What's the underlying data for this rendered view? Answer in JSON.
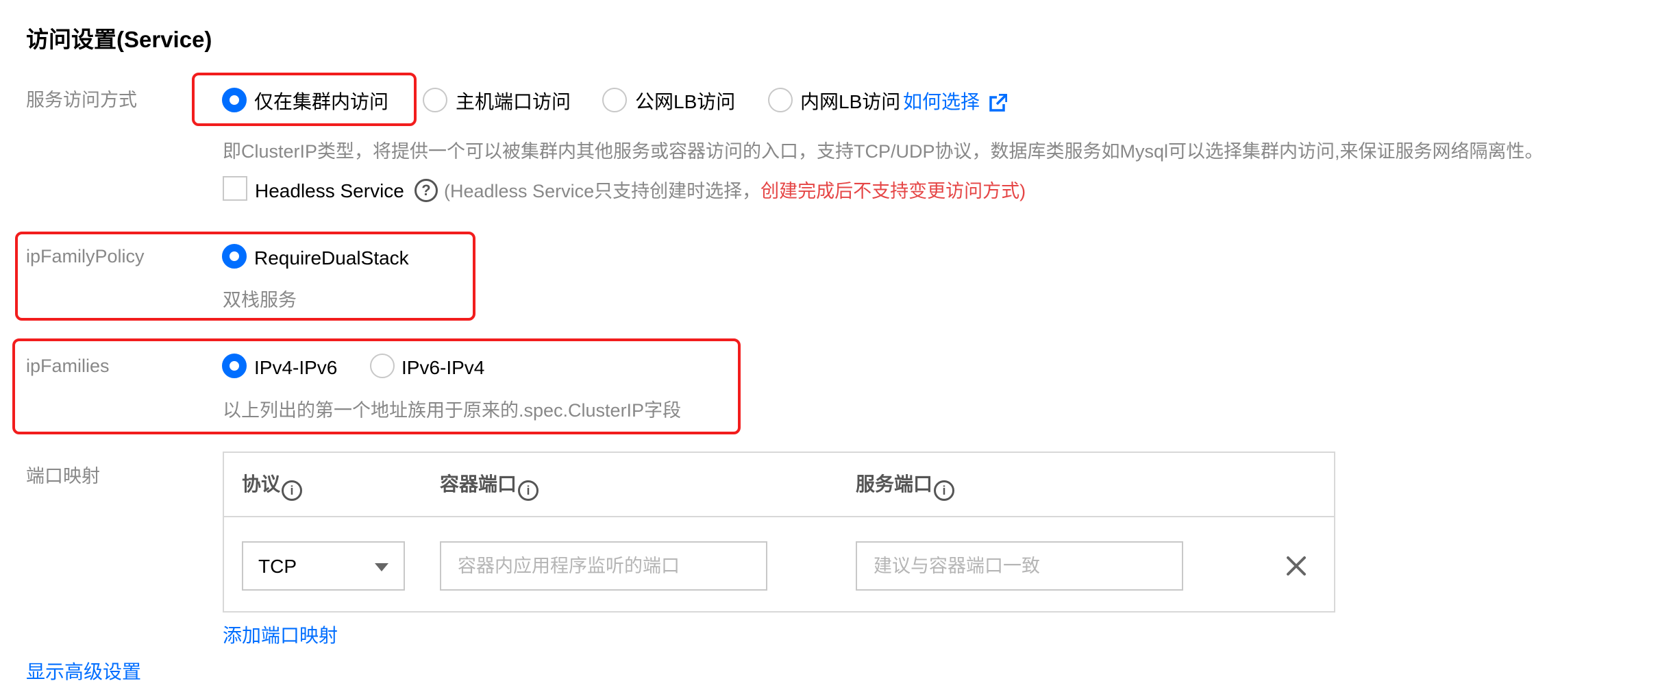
{
  "section_title": "访问设置(Service)",
  "service_access": {
    "label": "服务访问方式",
    "options": [
      {
        "label": "仅在集群内访问",
        "checked": true
      },
      {
        "label": "主机端口访问",
        "checked": false
      },
      {
        "label": "公网LB访问",
        "checked": false
      },
      {
        "label": "内网LB访问",
        "checked": false
      }
    ],
    "how_to_choose_link": "如何选择",
    "description": "即ClusterIP类型，将提供一个可以被集群内其他服务或容器访问的入口，支持TCP/UDP协议，数据库类服务如Mysql可以选择集群内访问,来保证服务网络隔离性。",
    "headless": {
      "label": "Headless Service",
      "checked": false,
      "note_prefix": "(Headless Service只支持创建时选择，",
      "note_warning": "创建完成后不支持变更访问方式)"
    }
  },
  "ip_family_policy": {
    "label": "ipFamilyPolicy",
    "option": {
      "label": "RequireDualStack",
      "checked": true
    },
    "description": "双栈服务"
  },
  "ip_families": {
    "label": "ipFamilies",
    "options": [
      {
        "label": "IPv4-IPv6",
        "checked": true
      },
      {
        "label": "IPv6-IPv4",
        "checked": false
      }
    ],
    "description": "以上列出的第一个地址族用于原来的.spec.ClusterIP字段"
  },
  "port_mapping": {
    "label": "端口映射",
    "columns": [
      "协议",
      "容器端口",
      "服务端口"
    ],
    "row": {
      "protocol": "TCP",
      "container_port_placeholder": "容器内应用程序监听的端口",
      "service_port_placeholder": "建议与容器端口一致"
    },
    "add_link": "添加端口映射"
  },
  "advanced_link": "显示高级设置",
  "colors": {
    "accent": "#006eff",
    "danger": "#e54545",
    "highlight": "#f21d1d"
  },
  "icons": {
    "external_link": "external-link-icon",
    "help": "help-icon",
    "info": "info-icon",
    "close": "close-icon",
    "dropdown": "chevron-down-icon"
  }
}
